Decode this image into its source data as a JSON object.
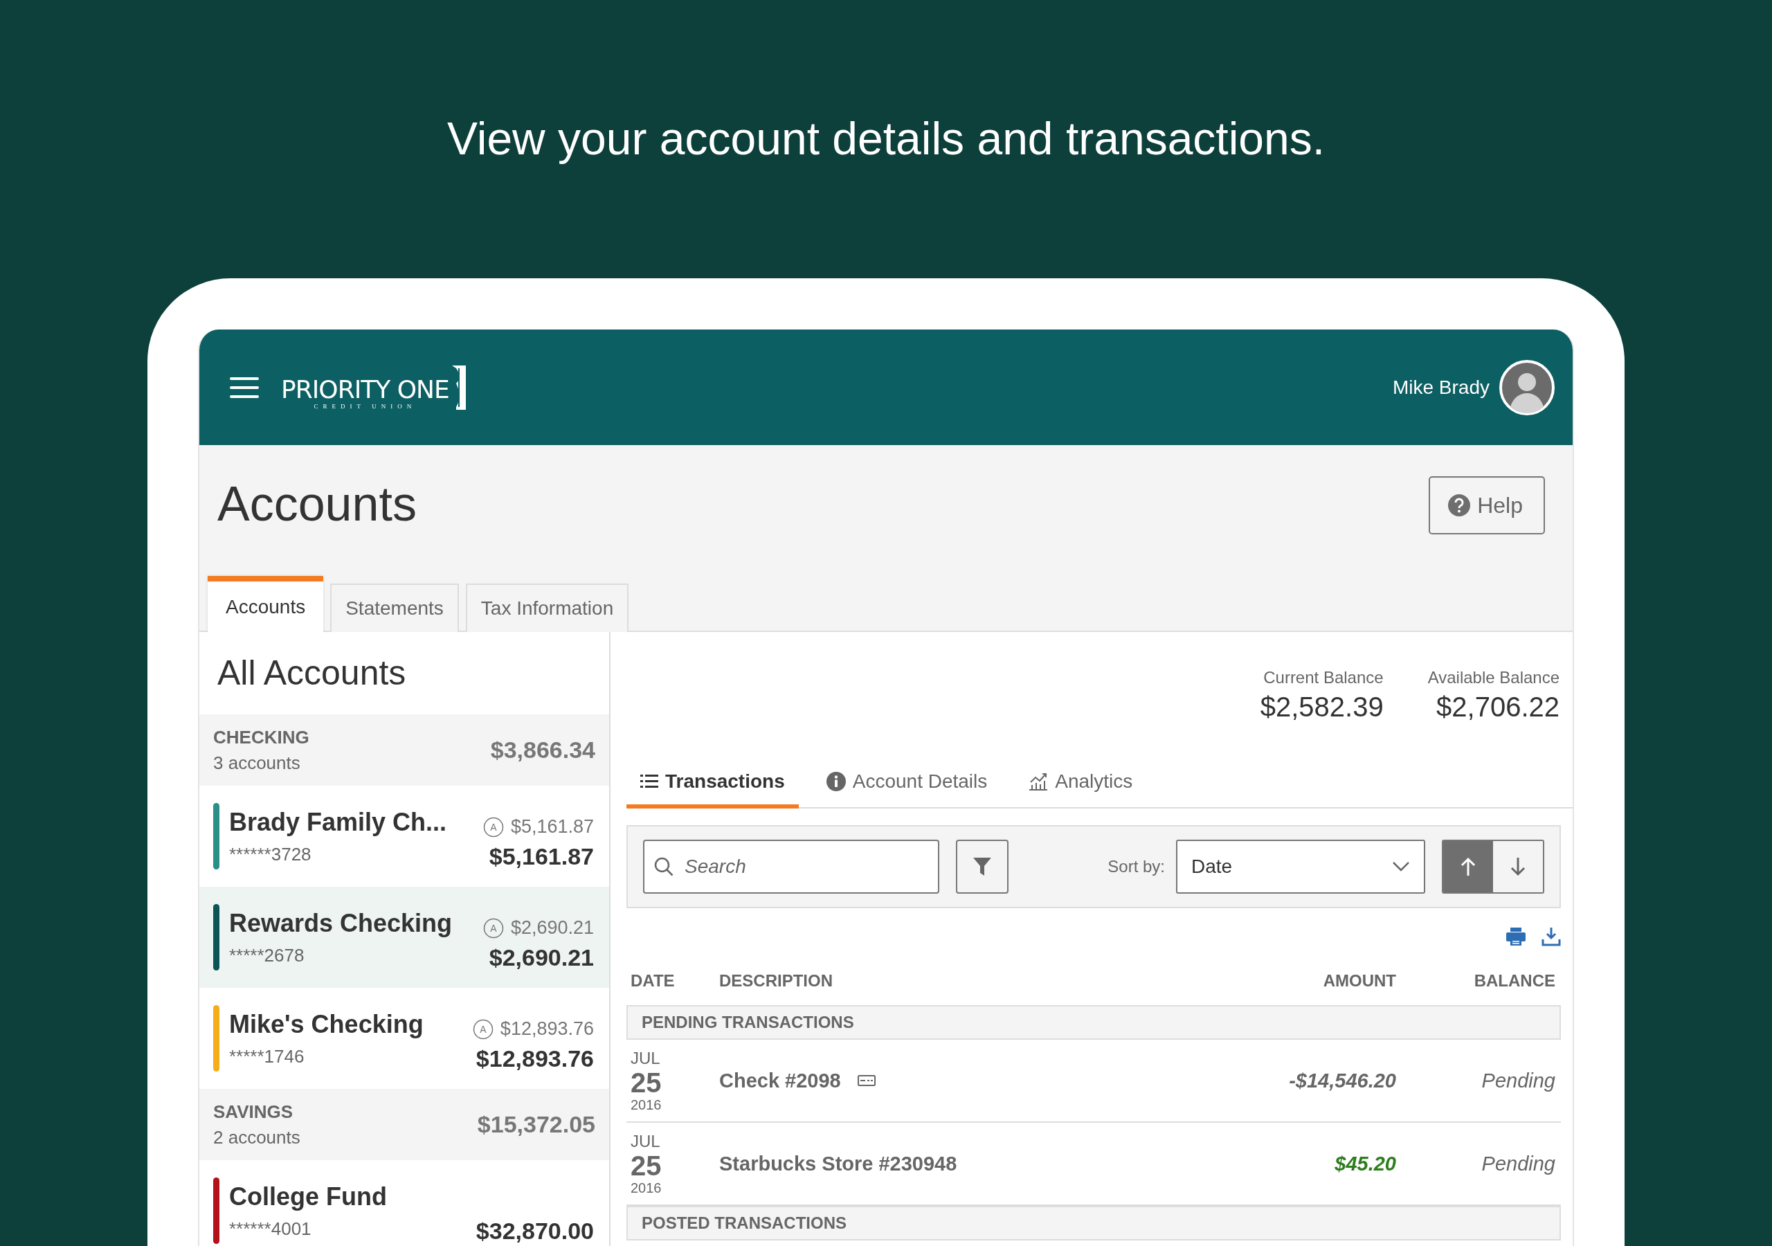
{
  "headline": "View your account details and transactions.",
  "header": {
    "logo": {
      "name": "PRIORITY ONE",
      "tagline": "CREDIT UNION"
    },
    "user": "Mike Brady"
  },
  "page": {
    "title": "Accounts",
    "help_button": "Help"
  },
  "tabs": [
    {
      "label": "Accounts",
      "selected": true
    },
    {
      "label": "Statements",
      "selected": false
    },
    {
      "label": "Tax Information",
      "selected": false
    }
  ],
  "sidebar": {
    "title": "All Accounts",
    "groups": [
      {
        "name": "CHECKING",
        "count": "3 accounts",
        "total": "$3,866.34",
        "accounts": [
          {
            "name": "Brady Family Ch...",
            "number": "******3728",
            "available_badge": "A",
            "available": "$5,161.87",
            "balance": "$5,161.87",
            "color": "#2a8f86",
            "selected": false
          },
          {
            "name": "Rewards Checking",
            "number": "*****2678",
            "available_badge": "A",
            "available": "$2,690.21",
            "balance": "$2,690.21",
            "color": "#0c5557",
            "selected": true
          },
          {
            "name": "Mike's Checking",
            "number": "*****1746",
            "available_badge": "A",
            "available": "$12,893.76",
            "balance": "$12,893.76",
            "color": "#f5ad1b",
            "selected": false
          }
        ]
      },
      {
        "name": "SAVINGS",
        "count": "2 accounts",
        "total": "$15,372.05",
        "accounts": [
          {
            "name": "College Fund",
            "number": "******4001",
            "balance": "$32,870.00",
            "color": "#b3121b",
            "selected": false
          }
        ]
      }
    ]
  },
  "account": {
    "current_balance": {
      "label": "Current Balance",
      "value": "$2,582.39"
    },
    "available_balance": {
      "label": "Available Balance",
      "value": "$2,706.22"
    },
    "tabs": [
      {
        "label": "Transactions",
        "kind": "list",
        "selected": true
      },
      {
        "label": "Account Details",
        "kind": "info",
        "selected": false
      },
      {
        "label": "Analytics",
        "kind": "chart",
        "selected": false
      }
    ],
    "toolbar": {
      "search": {
        "placeholder": "Search"
      },
      "sort_label": "Sort by:",
      "sort": {
        "value": "Date"
      },
      "sort_directions": [
        {
          "kind": "ascending",
          "selected": true
        },
        {
          "kind": "descending",
          "selected": false
        }
      ]
    },
    "table": {
      "columns": [
        "DATE",
        "DESCRIPTION",
        "AMOUNT",
        "BALANCE"
      ],
      "sections": [
        {
          "title": "PENDING TRANSACTIONS",
          "rows": [
            {
              "month": "JUL",
              "day": "25",
              "year": "2016",
              "description": "Check #2098",
              "check_image": true,
              "amount": "-$14,546.20",
              "kind": "debit",
              "balance": "Pending"
            },
            {
              "month": "JUL",
              "day": "25",
              "year": "2016",
              "description": "Starbucks Store #230948",
              "check_image": false,
              "amount": "$45.20",
              "kind": "credit",
              "balance": "Pending"
            }
          ]
        },
        {
          "title": "POSTED TRANSACTIONS"
        }
      ]
    }
  }
}
